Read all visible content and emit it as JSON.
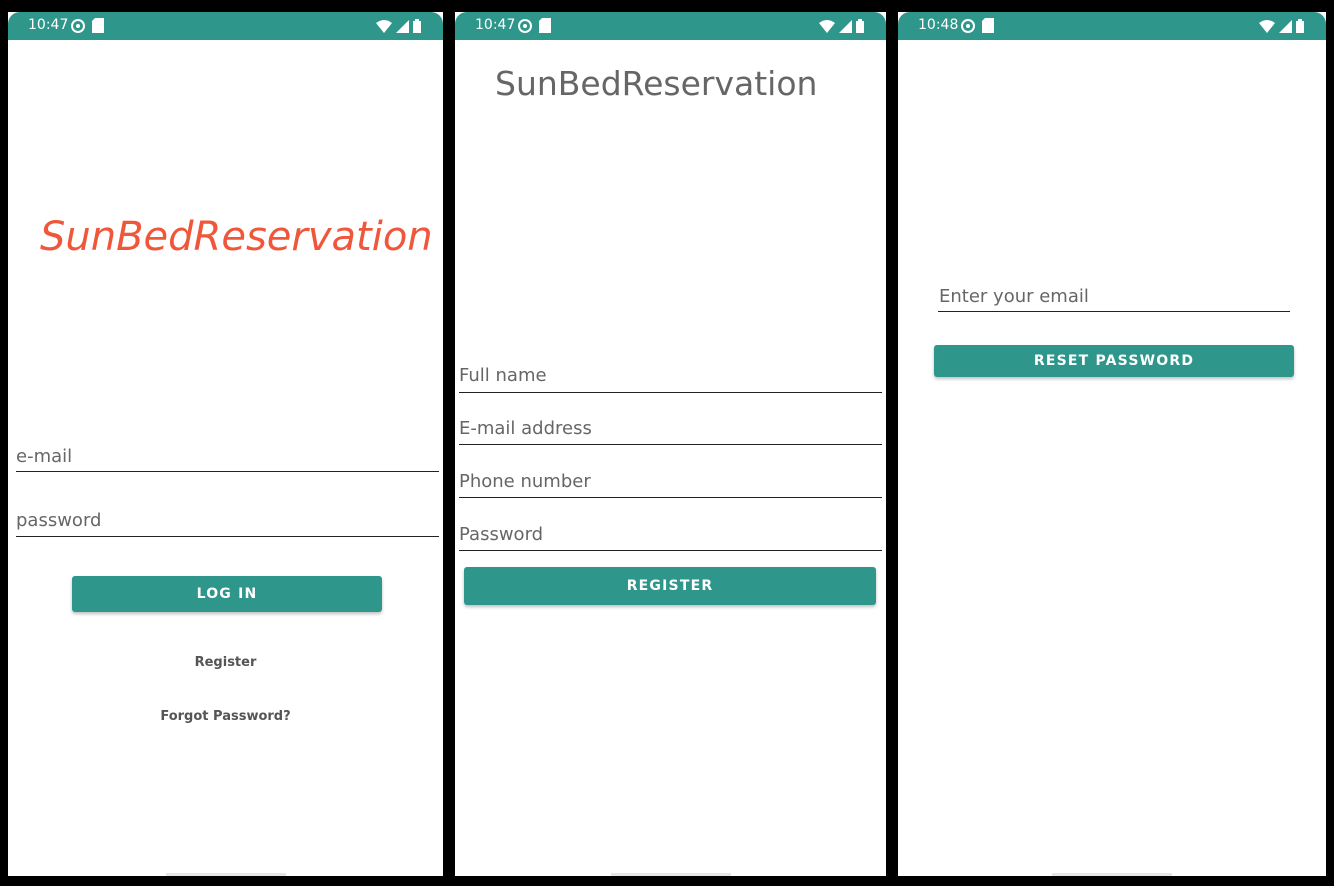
{
  "colors": {
    "accent": "#2e968a",
    "title_orange": "#f0563a"
  },
  "login": {
    "status_time": "10:47",
    "app_title": "SunBedReservation",
    "email_placeholder": "e-mail",
    "password_placeholder": "password",
    "login_button": "LOG IN",
    "register_link": "Register",
    "forgot_link": "Forgot Password?"
  },
  "register": {
    "status_time": "10:47",
    "app_title": "SunBedReservation",
    "fullname_placeholder": "Full name",
    "email_placeholder": "E-mail address",
    "phone_placeholder": "Phone number",
    "password_placeholder": "Password",
    "register_button": "REGISTER"
  },
  "reset": {
    "status_time": "10:48",
    "email_placeholder": "Enter your email",
    "reset_button": "RESET PASSWORD"
  },
  "icons": [
    "settings-icon",
    "sd-card-icon",
    "wifi-icon",
    "signal-icon",
    "battery-icon"
  ]
}
